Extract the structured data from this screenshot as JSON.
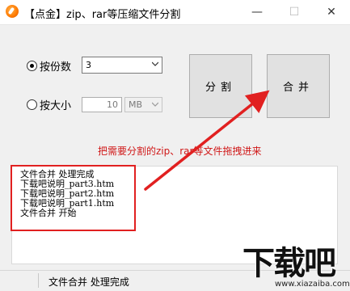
{
  "window": {
    "title": "【点金】zip、rar等压缩文件分割",
    "minimize_glyph": "—",
    "maximize_glyph": "☐",
    "close_glyph": "✕"
  },
  "options": {
    "by_count_label": "按份数",
    "by_count_selected": true,
    "count_value": "3",
    "by_size_label": "按大小",
    "by_size_selected": false,
    "size_value": "10",
    "size_unit": "MB"
  },
  "buttons": {
    "split_label": "分割",
    "merge_label": "合并"
  },
  "hint": "把需要分割的zip、rar等文件拖拽进来",
  "log": [
    "文件合并 处理完成",
    "下载吧说明_part3.htm",
    "下载吧说明_part2.htm",
    "下载吧说明_part1.htm",
    "文件合并 开始"
  ],
  "status": {
    "text": "文件合并 处理完成"
  },
  "watermark": {
    "logo_text": "下载吧",
    "url": "www.xiazaiba.com"
  },
  "colors": {
    "annotation_red": "#e12020",
    "hint_red": "#d01818"
  }
}
